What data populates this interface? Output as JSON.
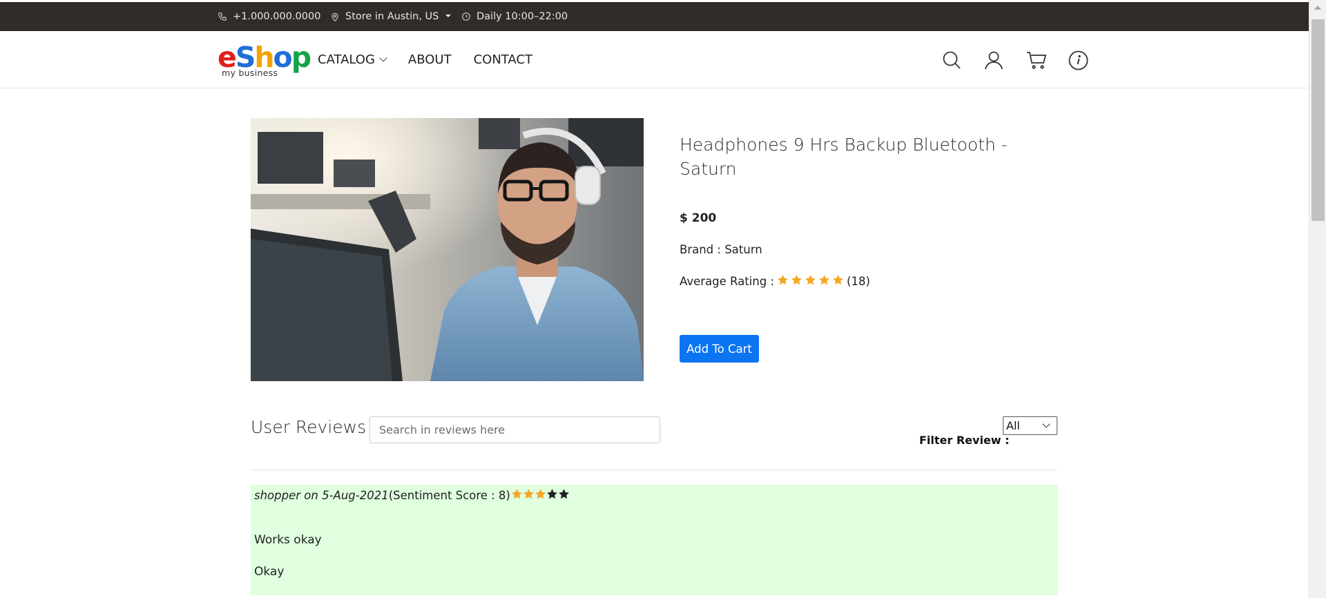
{
  "topbar": {
    "phone": "+1.000.000.0000",
    "store": "Store in Austin, US",
    "hours": "Daily 10:00–22:00",
    "background": "#2f2c2a"
  },
  "header": {
    "logo": {
      "letters": [
        {
          "char": "e",
          "color": "#e0201d"
        },
        {
          "char": "S",
          "color": "#1f6fd6"
        },
        {
          "char": "h",
          "color": "#f4a300"
        },
        {
          "char": "o",
          "color": "#1f6fd6"
        },
        {
          "char": "p",
          "color": "#16a34a"
        }
      ],
      "tagline": "my business"
    },
    "nav": [
      {
        "label": "CATALOG",
        "has_dropdown": true
      },
      {
        "label": "ABOUT",
        "has_dropdown": false
      },
      {
        "label": "CONTACT",
        "has_dropdown": false
      }
    ],
    "icons": [
      "search-icon",
      "user-icon",
      "cart-icon",
      "info-icon"
    ]
  },
  "product": {
    "title": "Headphones 9 Hrs Backup Bluetooth - Saturn",
    "price": "$ 200",
    "brand": "Brand : Saturn",
    "rating_label": "Average Rating :",
    "rating_stars": 5,
    "rating_count": "(18)",
    "star_color": "#f5a623",
    "add_to_cart": "Add To Cart",
    "button_color": "#0b74f0"
  },
  "reviews": {
    "heading": "User Reviews",
    "search_placeholder": "Search in reviews here",
    "filter_label": "Filter Review :",
    "filter_value": "All",
    "items": [
      {
        "author_date": "shopper on 5-Aug-2021",
        "sentiment": "(Sentiment Score : 8)",
        "stars_filled": 3,
        "stars_total": 5,
        "title": "Works okay",
        "body": "Okay",
        "background": "#dfffdf"
      }
    ]
  }
}
